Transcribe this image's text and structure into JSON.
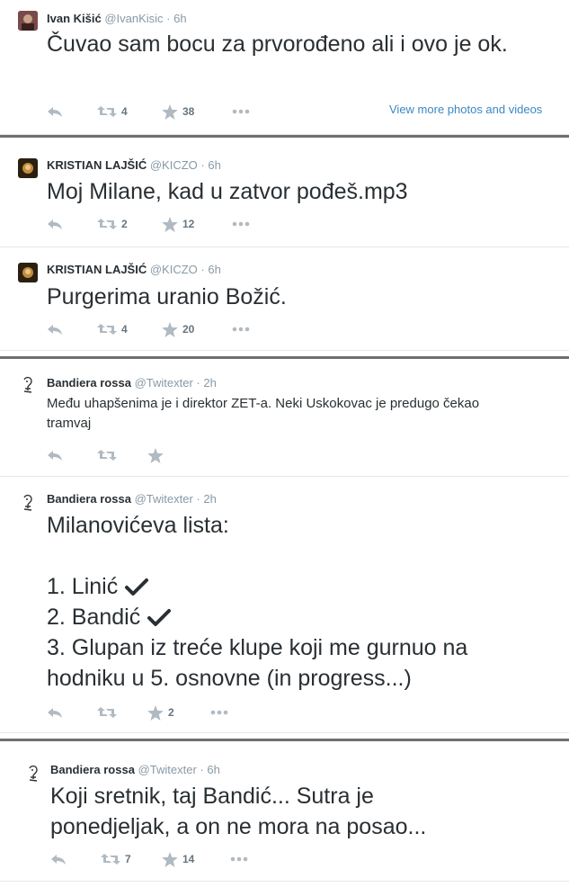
{
  "tweets": [
    {
      "name": "Ivan Kišić",
      "handle": "@IvanKisic",
      "time": "6h",
      "text": "Čuvao sam bocu za prvorođeno ali i ovo je ok.",
      "retweets": "4",
      "favorites": "38",
      "view_more": "View more photos and videos"
    },
    {
      "name": "KRISTIAN LAJŠIĆ",
      "handle": "@KICZO",
      "time": "6h",
      "text": "Moj Milane, kad u zatvor pođeš.mp3",
      "retweets": "2",
      "favorites": "12"
    },
    {
      "name": "KRISTIAN LAJŠIĆ",
      "handle": "@KICZO",
      "time": "6h",
      "text": "Purgerima uranio Božić.",
      "retweets": "4",
      "favorites": "20"
    },
    {
      "name": "Bandiera rossa",
      "handle": "@Twitexter",
      "time": "2h",
      "text_line1": "Među uhapšenima je i direktor ZET-a. Neki Uskokovac je predugo čekao",
      "text_line2": "tramvaj",
      "retweets": "",
      "favorites": ""
    },
    {
      "name": "Bandiera rossa",
      "handle": "@Twitexter",
      "time": "2h",
      "line1": "Milanovićeva lista:",
      "item1": "1. Linić",
      "item2": "2. Bandić",
      "item3_line1": "3. Glupan iz treće klupe koji me gurnuo na",
      "item3_line2": "hodniku u 5. osnovne (in progress...)",
      "retweets": "",
      "favorites": "2"
    },
    {
      "name": "Bandiera rossa",
      "handle": "@Twitexter",
      "time": "6h",
      "text_line1": "Koji sretnik, taj Bandić... Sutra je",
      "text_line2": "ponedjeljak, a on ne mora na posao...",
      "retweets": "7",
      "favorites": "14"
    }
  ],
  "separator_dot": "·",
  "colors": {
    "name": "#292f33",
    "meta": "#8899a6",
    "link": "#3b88c3",
    "icon": "#b0bac2",
    "separator": "#6f6f6f"
  }
}
